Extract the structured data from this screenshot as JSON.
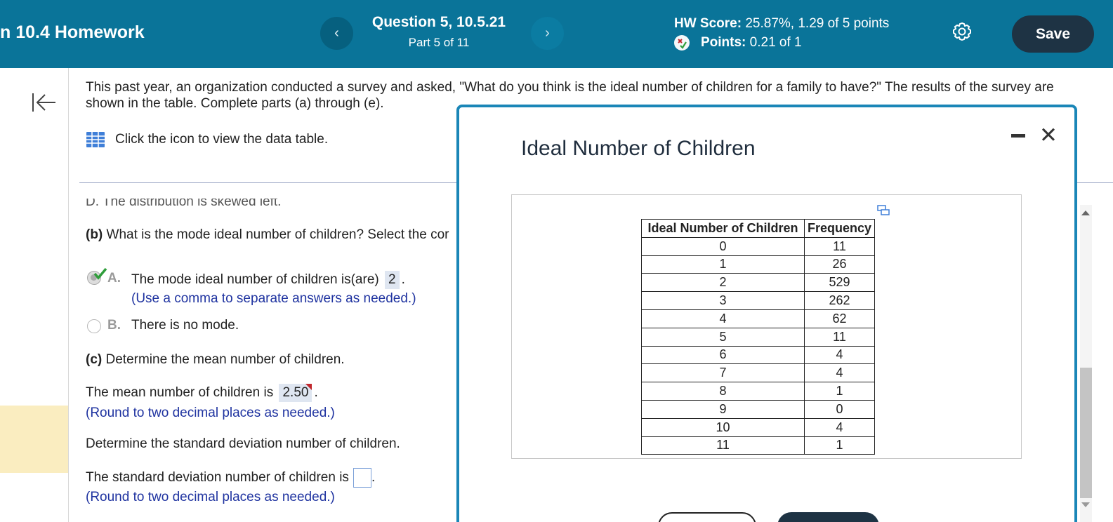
{
  "header": {
    "assignment_title": "n 10.4 Homework",
    "prev_label": "‹",
    "next_label": "›",
    "question_title": "Question 5, 10.5.21",
    "question_part": "Part 5 of 11",
    "hw_score_label": "HW Score:",
    "hw_score_value": "25.87%, 1.29 of 5 points",
    "points_label": "Points:",
    "points_value": "0.21 of 1",
    "save_label": "Save",
    "colors": {
      "bar": "#0a7499",
      "save": "#1e3344"
    }
  },
  "question": {
    "prompt": "This past year, an organization conducted a survey and asked, \"What do you think is the ideal number of children for a family to have?\" The results of the survey are shown in the table. Complete parts (a) through (e).",
    "data_link": "Click the icon to view the data table.",
    "cut_off_text": "D. The distribution is skewed left.",
    "part_b": {
      "label": "(b)",
      "text": "What is the mode ideal number of children? Select the cor",
      "option_a_letter": "A.",
      "option_a_text": "The mode ideal number of children is(are)",
      "option_a_answer": "2",
      "option_a_period": ".",
      "option_a_hint": "(Use a comma to separate answers as needed.)",
      "option_b_letter": "B.",
      "option_b_text": "There is no mode."
    },
    "part_c": {
      "label": "(c)",
      "text": "Determine the mean number of children.",
      "mean_text": "The mean number of children is",
      "mean_answer": "2.50",
      "mean_period": ".",
      "mean_hint": "(Round to two decimal places as needed.)",
      "sd_prompt": "Determine the standard deviation number of children.",
      "sd_text": "The standard deviation number of children is",
      "sd_period": ".",
      "sd_hint": "(Round to two decimal places as needed.)"
    }
  },
  "modal": {
    "title": "Ideal Number of Children",
    "minimize_label": "—",
    "close_label": "✕",
    "table": {
      "headers": [
        "Ideal Number of Children",
        "Frequency"
      ],
      "rows": [
        [
          "0",
          "11"
        ],
        [
          "1",
          "26"
        ],
        [
          "2",
          "529"
        ],
        [
          "3",
          "262"
        ],
        [
          "4",
          "62"
        ],
        [
          "5",
          "11"
        ],
        [
          "6",
          "4"
        ],
        [
          "7",
          "4"
        ],
        [
          "8",
          "1"
        ],
        [
          "9",
          "0"
        ],
        [
          "10",
          "4"
        ],
        [
          "11",
          "1"
        ]
      ]
    }
  }
}
